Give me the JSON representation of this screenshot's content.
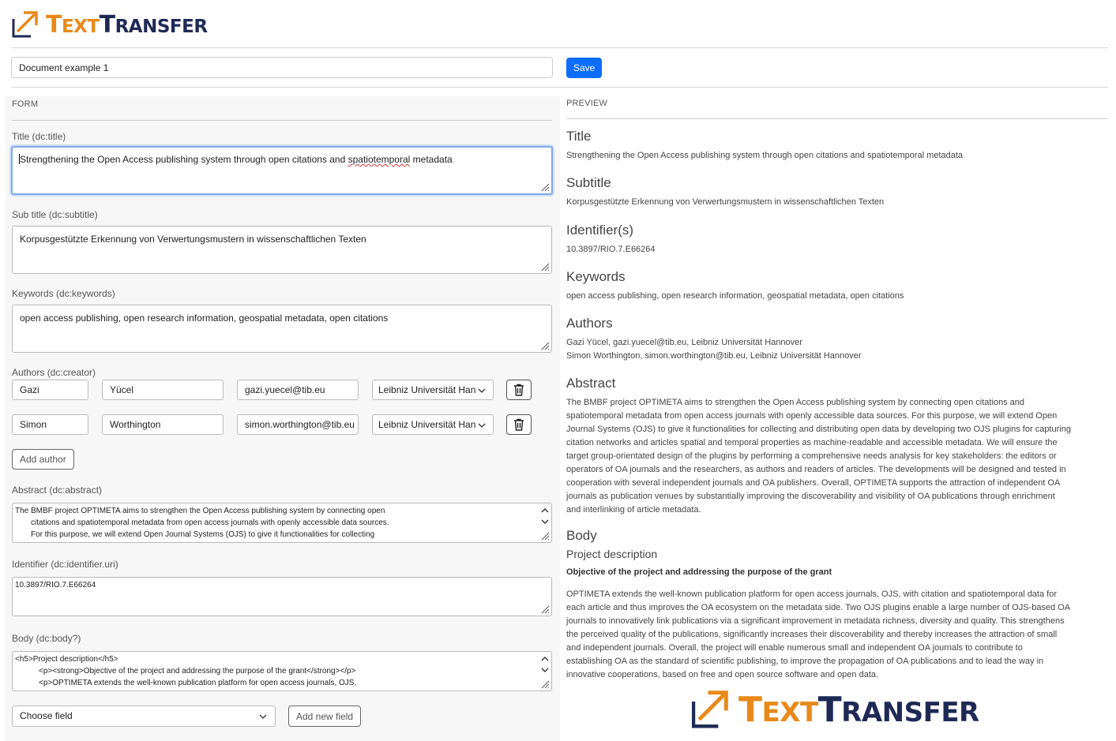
{
  "app": {
    "logo_part1": "Text",
    "logo_part2": "Transfer",
    "logo_word1_first": "T",
    "logo_word1_rest": "EXT",
    "logo_word2_first": "T",
    "logo_word2_rest": "RANSFER"
  },
  "toolbar": {
    "document_name": "Document example 1",
    "save_label": "Save"
  },
  "form": {
    "caption": "FORM",
    "title_label": "Title (dc:title)",
    "title_value_a": "Strengthening the Open Access publishing system through open citations and ",
    "title_value_b": "spatiotemporal",
    "title_value_c": " metadata",
    "subtitle_label": "Sub title (dc:subtitle)",
    "subtitle_value": "Korpusgestützte Erkennung von Verwertungsmustern in wissenschaftlichen Texten",
    "keywords_label": "Keywords (dc:keywords)",
    "keywords_value": "open access publishing, open research information, geospatial metadata, open citations",
    "authors_label": "Authors (dc:creator)",
    "authors": [
      {
        "given": "Gazi",
        "family": "Yücel",
        "email": "gazi.yuecel@tib.eu",
        "affiliation": "Leibniz Universität Han"
      },
      {
        "given": "Simon",
        "family": "Worthington",
        "email": "simon.worthington@tib.eu",
        "affiliation": "Leibniz Universität Han"
      }
    ],
    "add_author_label": "Add author",
    "abstract_label": "Abstract (dc:abstract)",
    "abstract_lines": [
      "The BMBF project OPTIMETA aims to strengthen the Open Access publishing system by connecting open",
      "citations and spatiotemporal metadata from open access journals with openly accessible data sources.",
      "For this purpose, we will extend Open Journal Systems (OJS) to give it functionalities for collecting"
    ],
    "identifier_label": "Identifier (dc:identifier.uri)",
    "identifier_value": "10.3897/RIO.7.E66264",
    "body_label": "Body (dc:body?)",
    "body_lines": [
      "<h5>Project description</h5>",
      "<p><strong>Objective of the project and addressing the purpose of the grant</strong></p>",
      "<p>OPTIMETA extends the well-known publication platform for open access journals, OJS,"
    ],
    "choose_field_label": "Choose field",
    "add_new_field_label": "Add new field"
  },
  "preview": {
    "caption": "PREVIEW",
    "title_heading": "Title",
    "title_text": "Strengthening the Open Access publishing system through open citations and spatiotemporal metadata",
    "subtitle_heading": "Subtitle",
    "subtitle_text": "Korpusgestützte Erkennung von Verwertungsmustern in wissenschaftlichen Texten",
    "identifier_heading": "Identifier(s)",
    "identifier_text": "10.3897/RIO.7.E66264",
    "keywords_heading": "Keywords",
    "keywords_text": "open access publishing, open research information, geospatial metadata, open citations",
    "authors_heading": "Authors",
    "authors_lines": [
      "Gazi Yücel, gazi.yuecel@tib.eu, Leibniz Universität Hannover",
      "Simon Worthington, simon.worthington@tib.eu, Leibniz Universität Hannover"
    ],
    "abstract_heading": "Abstract",
    "abstract_lines": [
      "The BMBF project OPTIMETA aims to strengthen the Open Access publishing system by connecting open citations and",
      "spatiotemporal metadata from open access journals with openly accessible data sources. For this purpose, we will extend Open",
      "Journal Systems (OJS) to give it functionalities for collecting and distributing open data by developing two OJS plugins for capturing",
      "citation networks and articles spatial and temporal properties as machine-readable and accessible metadata. We will ensure the",
      "target group-orientated design of the plugins by performing a comprehensive needs analysis for key stakeholders: the editors or",
      "operators of OA journals and the researchers, as authors and readers of articles. The developments will be designed and tested in",
      "cooperation with several independent journals and OA publishers. Overall, OPTIMETA supports the attraction of independent OA",
      "journals as publication venues by substantially improving the discoverability and visibility of OA publications through enrichment",
      "and interlinking of article metadata."
    ],
    "body_heading": "Body",
    "body_subheading": "Project description",
    "body_strong": "Objective of the project and addressing the purpose of the grant",
    "body_lines": [
      "OPTIMETA extends the well-known publication platform for open access journals, OJS, with citation and spatiotemporal data for",
      "each article and thus improves the OA ecosystem on the metadata side. Two OJS plugins enable a large number of OJS-based OA",
      "journals to innovatively link publications via a significant improvement in metadata richness, diversity and quality. This strengthens",
      "the perceived quality of the publications, significantly increases their discoverability and thereby increases the attraction of small",
      "and independent journals. Overall, the project will enable numerous small and independent OA journals to contribute to",
      "establishing OA as the standard of scientific publishing, to improve the propagation of OA publications and to lead the way in",
      "innovative cooperations, based on free and open source software and open data."
    ]
  },
  "colors": {
    "brand_orange": "#e8891a",
    "brand_navy": "#1e2a55",
    "primary": "#0d6efd"
  },
  "icons": {
    "trash": "trash-icon",
    "chevron": "chevron-down-icon",
    "resize": "resize-grip-icon",
    "logo": "arrow-logo-icon"
  }
}
